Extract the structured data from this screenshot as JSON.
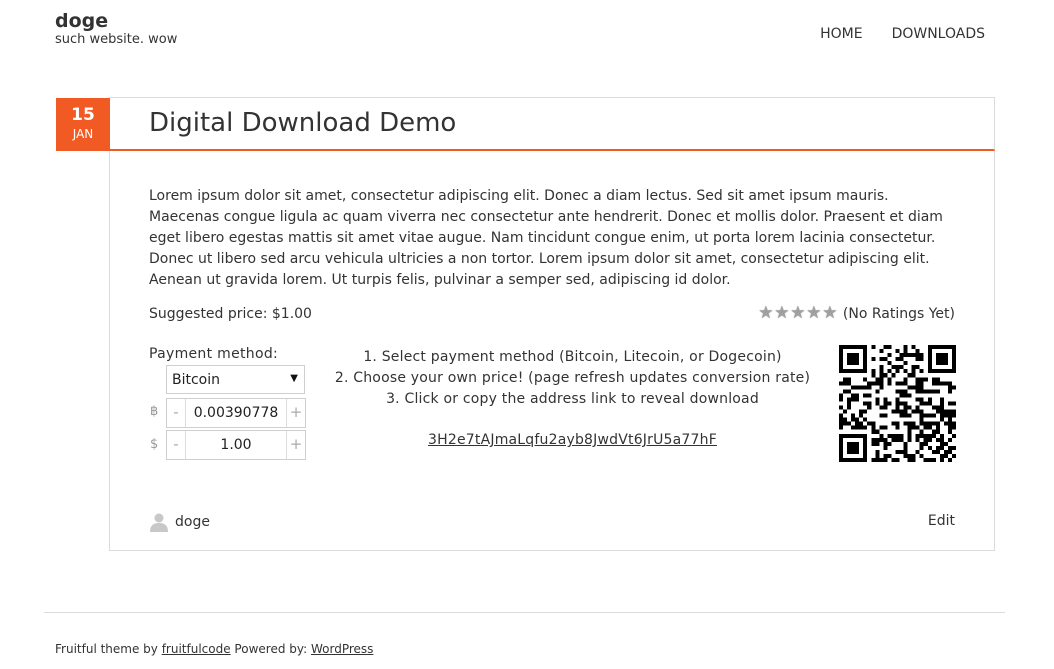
{
  "site": {
    "title": "doge",
    "tagline": "such website. wow"
  },
  "nav": {
    "items": [
      "HOME",
      "DOWNLOADS"
    ]
  },
  "post": {
    "date_day": "15",
    "date_month": "JAN",
    "title": "Digital Download Demo",
    "excerpt": "Lorem ipsum dolor sit amet, consectetur adipiscing elit. Donec a diam lectus. Sed sit amet ipsum mauris. Maecenas congue ligula ac quam viverra nec consectetur ante hendrerit. Donec et mollis dolor. Praesent et diam eget libero egestas mattis sit amet vitae augue. Nam tincidunt congue enim, ut porta lorem lacinia consectetur. Donec ut libero sed arcu vehicula ultricies a non tortor. Lorem ipsum dolor sit amet, consectetur adipiscing elit. Aenean ut gravida lorem. Ut turpis felis, pulvinar a semper sed, adipiscing id dolor.",
    "suggested_price": "Suggested price: $1.00",
    "ratings_text": "(No Ratings Yet)",
    "author": "doge",
    "edit_label": "Edit"
  },
  "payment": {
    "label": "Payment method:",
    "selected": "Bitcoin",
    "crypto_symbol": "฿",
    "crypto_amount": "0.00390778",
    "fiat_symbol": "$",
    "fiat_amount": "1.00",
    "minus": "-",
    "plus": "+",
    "instructions": [
      "1. Select payment method (Bitcoin, Litecoin, or Dogecoin)",
      "2. Choose your own price! (page refresh updates conversion rate)",
      "3. Click or copy the address link to reveal download"
    ],
    "address": "3H2e7tAJmaLqfu2ayb8JwdVt6JrU5a77hF"
  },
  "footer": {
    "prefix": "Fruitful theme by ",
    "theme_link": "fruitfulcode",
    "middle": " Powered by: ",
    "wp_link": "WordPress"
  },
  "colors": {
    "accent": "#f15a23",
    "border": "#dcdcdc"
  }
}
